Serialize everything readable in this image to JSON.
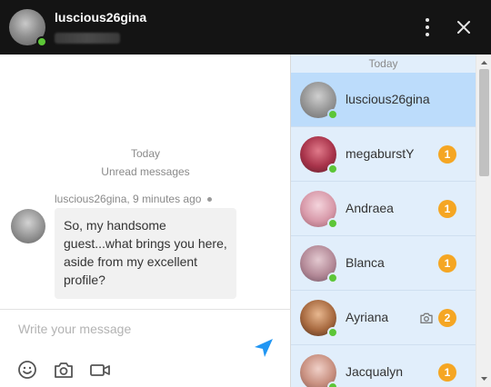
{
  "header": {
    "username": "luscious26gina",
    "icons": [
      "more-vert-icon",
      "close-icon"
    ]
  },
  "chat": {
    "day_label": "Today",
    "unread_label": "Unread messages",
    "message": {
      "meta": "luscious26gina, 9 minutes ago",
      "text": "So, my handsome guest...what brings you here, aside from my excellent profile?"
    }
  },
  "composer": {
    "placeholder": "Write your message",
    "icons": [
      "send-icon",
      "emoji-icon",
      "camera-icon",
      "video-icon"
    ]
  },
  "sidebar": {
    "day_label": "Today",
    "contacts": [
      {
        "name": "luscious26gina",
        "badge": "",
        "active": true
      },
      {
        "name": "megaburstY",
        "badge": "1"
      },
      {
        "name": "Andraea",
        "badge": "1"
      },
      {
        "name": "Blanca",
        "badge": "1"
      },
      {
        "name": "Ayriana",
        "badge": "2",
        "icon": "camera-icon"
      },
      {
        "name": "Jacqualyn",
        "badge": "1"
      }
    ]
  },
  "colors": {
    "header_bg": "#141414",
    "online": "#5cc637",
    "badge": "#f5a623",
    "active_contact": "#bcdcfb",
    "sidebar_bg": "#e1eefb",
    "send_icon": "#2196f3"
  }
}
